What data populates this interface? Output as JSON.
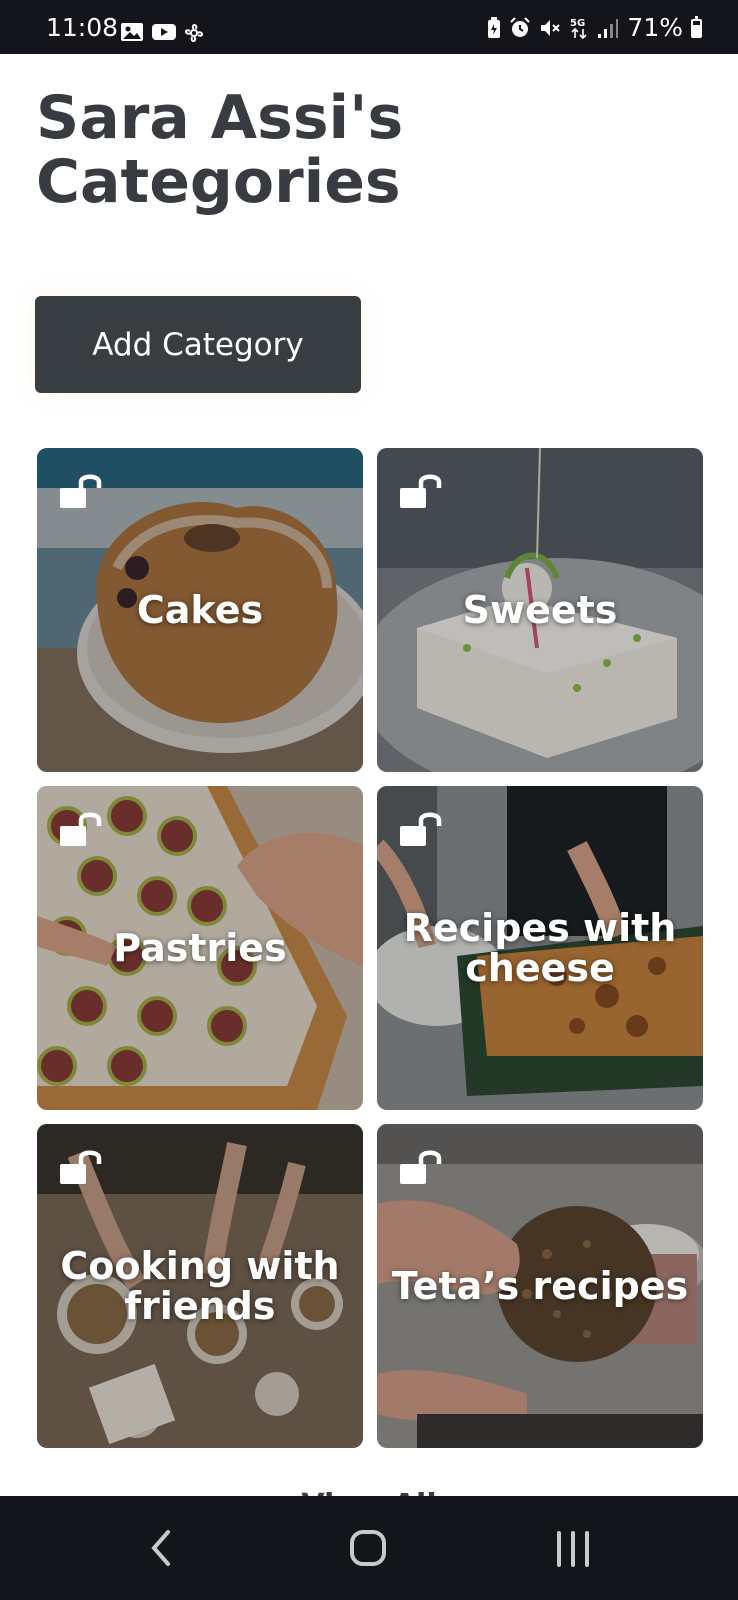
{
  "status_bar": {
    "time": "11:08",
    "left_icons": [
      "gallery-icon",
      "youtube-icon",
      "pinwheel-icon"
    ],
    "right_icons": [
      "battery-saver-icon",
      "alarm-icon",
      "mute-icon",
      "5g-icon",
      "signal-icon"
    ],
    "battery_percent": "71%",
    "battery_level": 0.71
  },
  "page": {
    "title": "Sara Assi's Categories",
    "add_button_label": "Add Category",
    "view_all_label": "View All"
  },
  "categories": [
    {
      "label": "Cakes",
      "locked": false,
      "image": "bundt-cake-photo"
    },
    {
      "label": "Sweets",
      "locked": false,
      "image": "milk-pudding-dessert-photo"
    },
    {
      "label": "Pastries",
      "locked": false,
      "image": "fig-tart-photo"
    },
    {
      "label": "Recipes with cheese",
      "locked": false,
      "image": "cheese-casserole-photo"
    },
    {
      "label": "Cooking with friends",
      "locked": false,
      "image": "group-cooking-table-photo"
    },
    {
      "label": "Teta’s recipes",
      "locked": false,
      "image": "flatbread-cracker-photo"
    }
  ],
  "nav_bar": {
    "buttons": [
      "back-icon",
      "home-icon",
      "recents-icon"
    ]
  },
  "colors": {
    "status_bar_bg": "#13151a",
    "title_text": "#383c41",
    "button_bg": "#383d42",
    "nav_bar_bg": "#13151a"
  }
}
